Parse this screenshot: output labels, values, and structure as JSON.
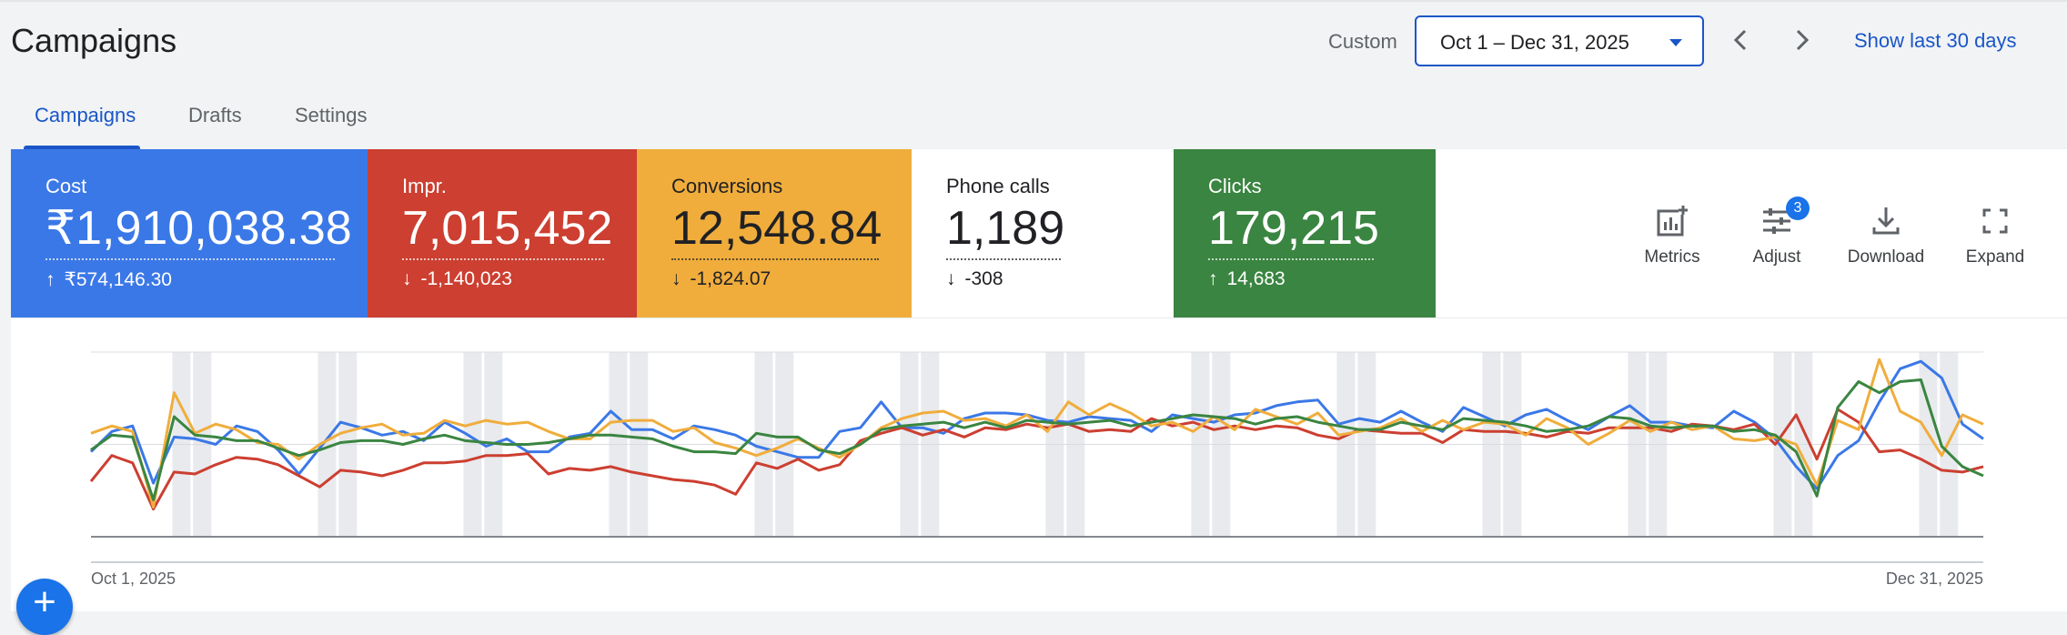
{
  "header": {
    "title": "Campaigns",
    "custom_label": "Custom",
    "date_range": "Oct 1 – Dec 31, 2025",
    "show_last": "Show last 30 days"
  },
  "tabs": [
    {
      "label": "Campaigns",
      "active": true
    },
    {
      "label": "Drafts",
      "active": false
    },
    {
      "label": "Settings",
      "active": false
    }
  ],
  "metrics": [
    {
      "label": "Cost",
      "value": "₹1,910,038.38",
      "delta": "₹574,146.30",
      "direction": "up",
      "bg": "#3b78e7",
      "fg": "#ffffff"
    },
    {
      "label": "Impr.",
      "value": "7,015,452",
      "delta": "-1,140,023",
      "direction": "down",
      "bg": "#cc3f31",
      "fg": "#ffffff"
    },
    {
      "label": "Conversions",
      "value": "12,548.84",
      "delta": "-1,824.07",
      "direction": "down",
      "bg": "#f0ad3c",
      "fg": "#202124"
    },
    {
      "label": "Phone calls",
      "value": "1,189",
      "delta": "-308",
      "direction": "down",
      "bg": "#ffffff",
      "fg": "#202124"
    },
    {
      "label": "Clicks",
      "value": "179,215",
      "delta": "14,683",
      "direction": "up",
      "bg": "#3a8541",
      "fg": "#ffffff"
    }
  ],
  "tools": [
    {
      "label": "Metrics",
      "icon": "chart-add-icon"
    },
    {
      "label": "Adjust",
      "icon": "tune-icon",
      "badge": "3"
    },
    {
      "label": "Download",
      "icon": "download-icon"
    },
    {
      "label": "Expand",
      "icon": "expand-icon"
    }
  ],
  "chart_data": {
    "type": "line",
    "x_start_label": "Oct 1, 2025",
    "x_end_label": "Dec 31, 2025",
    "x_points": 92,
    "weekend_days": [
      4,
      5,
      11,
      12,
      18,
      19,
      25,
      26,
      32,
      33,
      39,
      40,
      46,
      47,
      53,
      54,
      60,
      61,
      67,
      68,
      74,
      75,
      81,
      82,
      88,
      89
    ],
    "ylim": [
      0,
      100
    ],
    "grid": true,
    "series": [
      {
        "color": "#3b78e7",
        "values": [
          46,
          57,
          60,
          29,
          54,
          53,
          50,
          60,
          57,
          47,
          34,
          48,
          62,
          59,
          55,
          57,
          52,
          62,
          56,
          49,
          53,
          46,
          46,
          54,
          56,
          68,
          58,
          58,
          53,
          60,
          58,
          55,
          49,
          46,
          43,
          43,
          57,
          59,
          73,
          59,
          59,
          56,
          64,
          67,
          67,
          66,
          63,
          62,
          65,
          64,
          63,
          57,
          66,
          64,
          62,
          66,
          67,
          71,
          73,
          74,
          61,
          64,
          62,
          68,
          62,
          57,
          70,
          65,
          60,
          66,
          69,
          63,
          58,
          65,
          71,
          62,
          62,
          60,
          59,
          68,
          62,
          53,
          38,
          26,
          44,
          52,
          73,
          91,
          95,
          86,
          61,
          53
        ]
      },
      {
        "color": "#cc3f31",
        "values": [
          30,
          44,
          40,
          15,
          35,
          34,
          39,
          43,
          42,
          39,
          33,
          27,
          36,
          35,
          33,
          36,
          40,
          40,
          41,
          44,
          44,
          45,
          34,
          37,
          36,
          38,
          35,
          33,
          31,
          30,
          28,
          23,
          40,
          37,
          42,
          36,
          39,
          52,
          56,
          59,
          55,
          58,
          54,
          59,
          58,
          61,
          59,
          61,
          57,
          58,
          57,
          64,
          60,
          62,
          58,
          60,
          58,
          60,
          59,
          55,
          53,
          58,
          57,
          56,
          56,
          51,
          58,
          57,
          57,
          56,
          54,
          57,
          56,
          59,
          59,
          59,
          57,
          61,
          60,
          58,
          61,
          50,
          66,
          42,
          69,
          62,
          46,
          47,
          42,
          36,
          35,
          38
        ]
      },
      {
        "color": "#f0ad3c",
        "values": [
          56,
          60,
          57,
          16,
          78,
          56,
          61,
          58,
          51,
          50,
          42,
          50,
          56,
          59,
          61,
          55,
          56,
          63,
          60,
          63,
          61,
          62,
          57,
          53,
          53,
          62,
          63,
          63,
          57,
          59,
          51,
          48,
          44,
          48,
          53,
          48,
          43,
          50,
          59,
          64,
          67,
          68,
          63,
          64,
          60,
          66,
          57,
          73,
          66,
          72,
          67,
          60,
          62,
          57,
          65,
          58,
          69,
          65,
          61,
          67,
          55,
          57,
          59,
          64,
          57,
          63,
          58,
          62,
          61,
          55,
          64,
          59,
          50,
          56,
          63,
          57,
          62,
          58,
          60,
          53,
          52,
          54,
          50,
          28,
          63,
          58,
          96,
          68,
          62,
          44,
          66,
          61
        ]
      },
      {
        "color": "#3a8541",
        "values": [
          47,
          55,
          54,
          20,
          65,
          55,
          54,
          52,
          52,
          48,
          44,
          47,
          51,
          52,
          52,
          50,
          53,
          55,
          52,
          51,
          50,
          50,
          51,
          53,
          55,
          55,
          54,
          53,
          49,
          46,
          46,
          45,
          56,
          54,
          54,
          47,
          45,
          50,
          58,
          60,
          61,
          62,
          59,
          62,
          59,
          63,
          62,
          61,
          62,
          63,
          60,
          62,
          64,
          66,
          65,
          64,
          61,
          64,
          65,
          62,
          60,
          58,
          58,
          62,
          60,
          58,
          64,
          63,
          62,
          60,
          57,
          58,
          60,
          65,
          64,
          60,
          59,
          60,
          60,
          57,
          58,
          55,
          46,
          22,
          70,
          84,
          78,
          84,
          85,
          49,
          38,
          33
        ]
      }
    ]
  }
}
